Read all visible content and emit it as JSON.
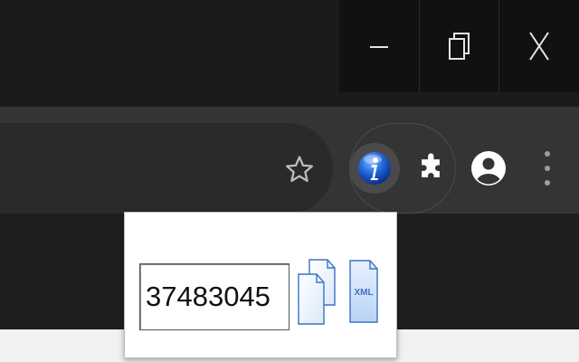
{
  "window_controls": {
    "minimize_icon": "minimize-icon",
    "restore_icon": "restore-icon",
    "close_icon": "close-icon"
  },
  "toolbar": {
    "bookmark_icon": "star-icon",
    "extensions": [
      {
        "name": "info-extension",
        "icon": "info-icon",
        "color": "#1565c0"
      },
      {
        "name": "extensions-menu",
        "icon": "puzzle-icon",
        "color": "#ffffff"
      }
    ],
    "profile_icon": "account-icon",
    "menu_icon": "kebab-menu-icon"
  },
  "popup": {
    "id_value": "37483045",
    "copy_icon": "copy-icon",
    "xml_label": "XML",
    "accent_color": "#3a73c6"
  }
}
